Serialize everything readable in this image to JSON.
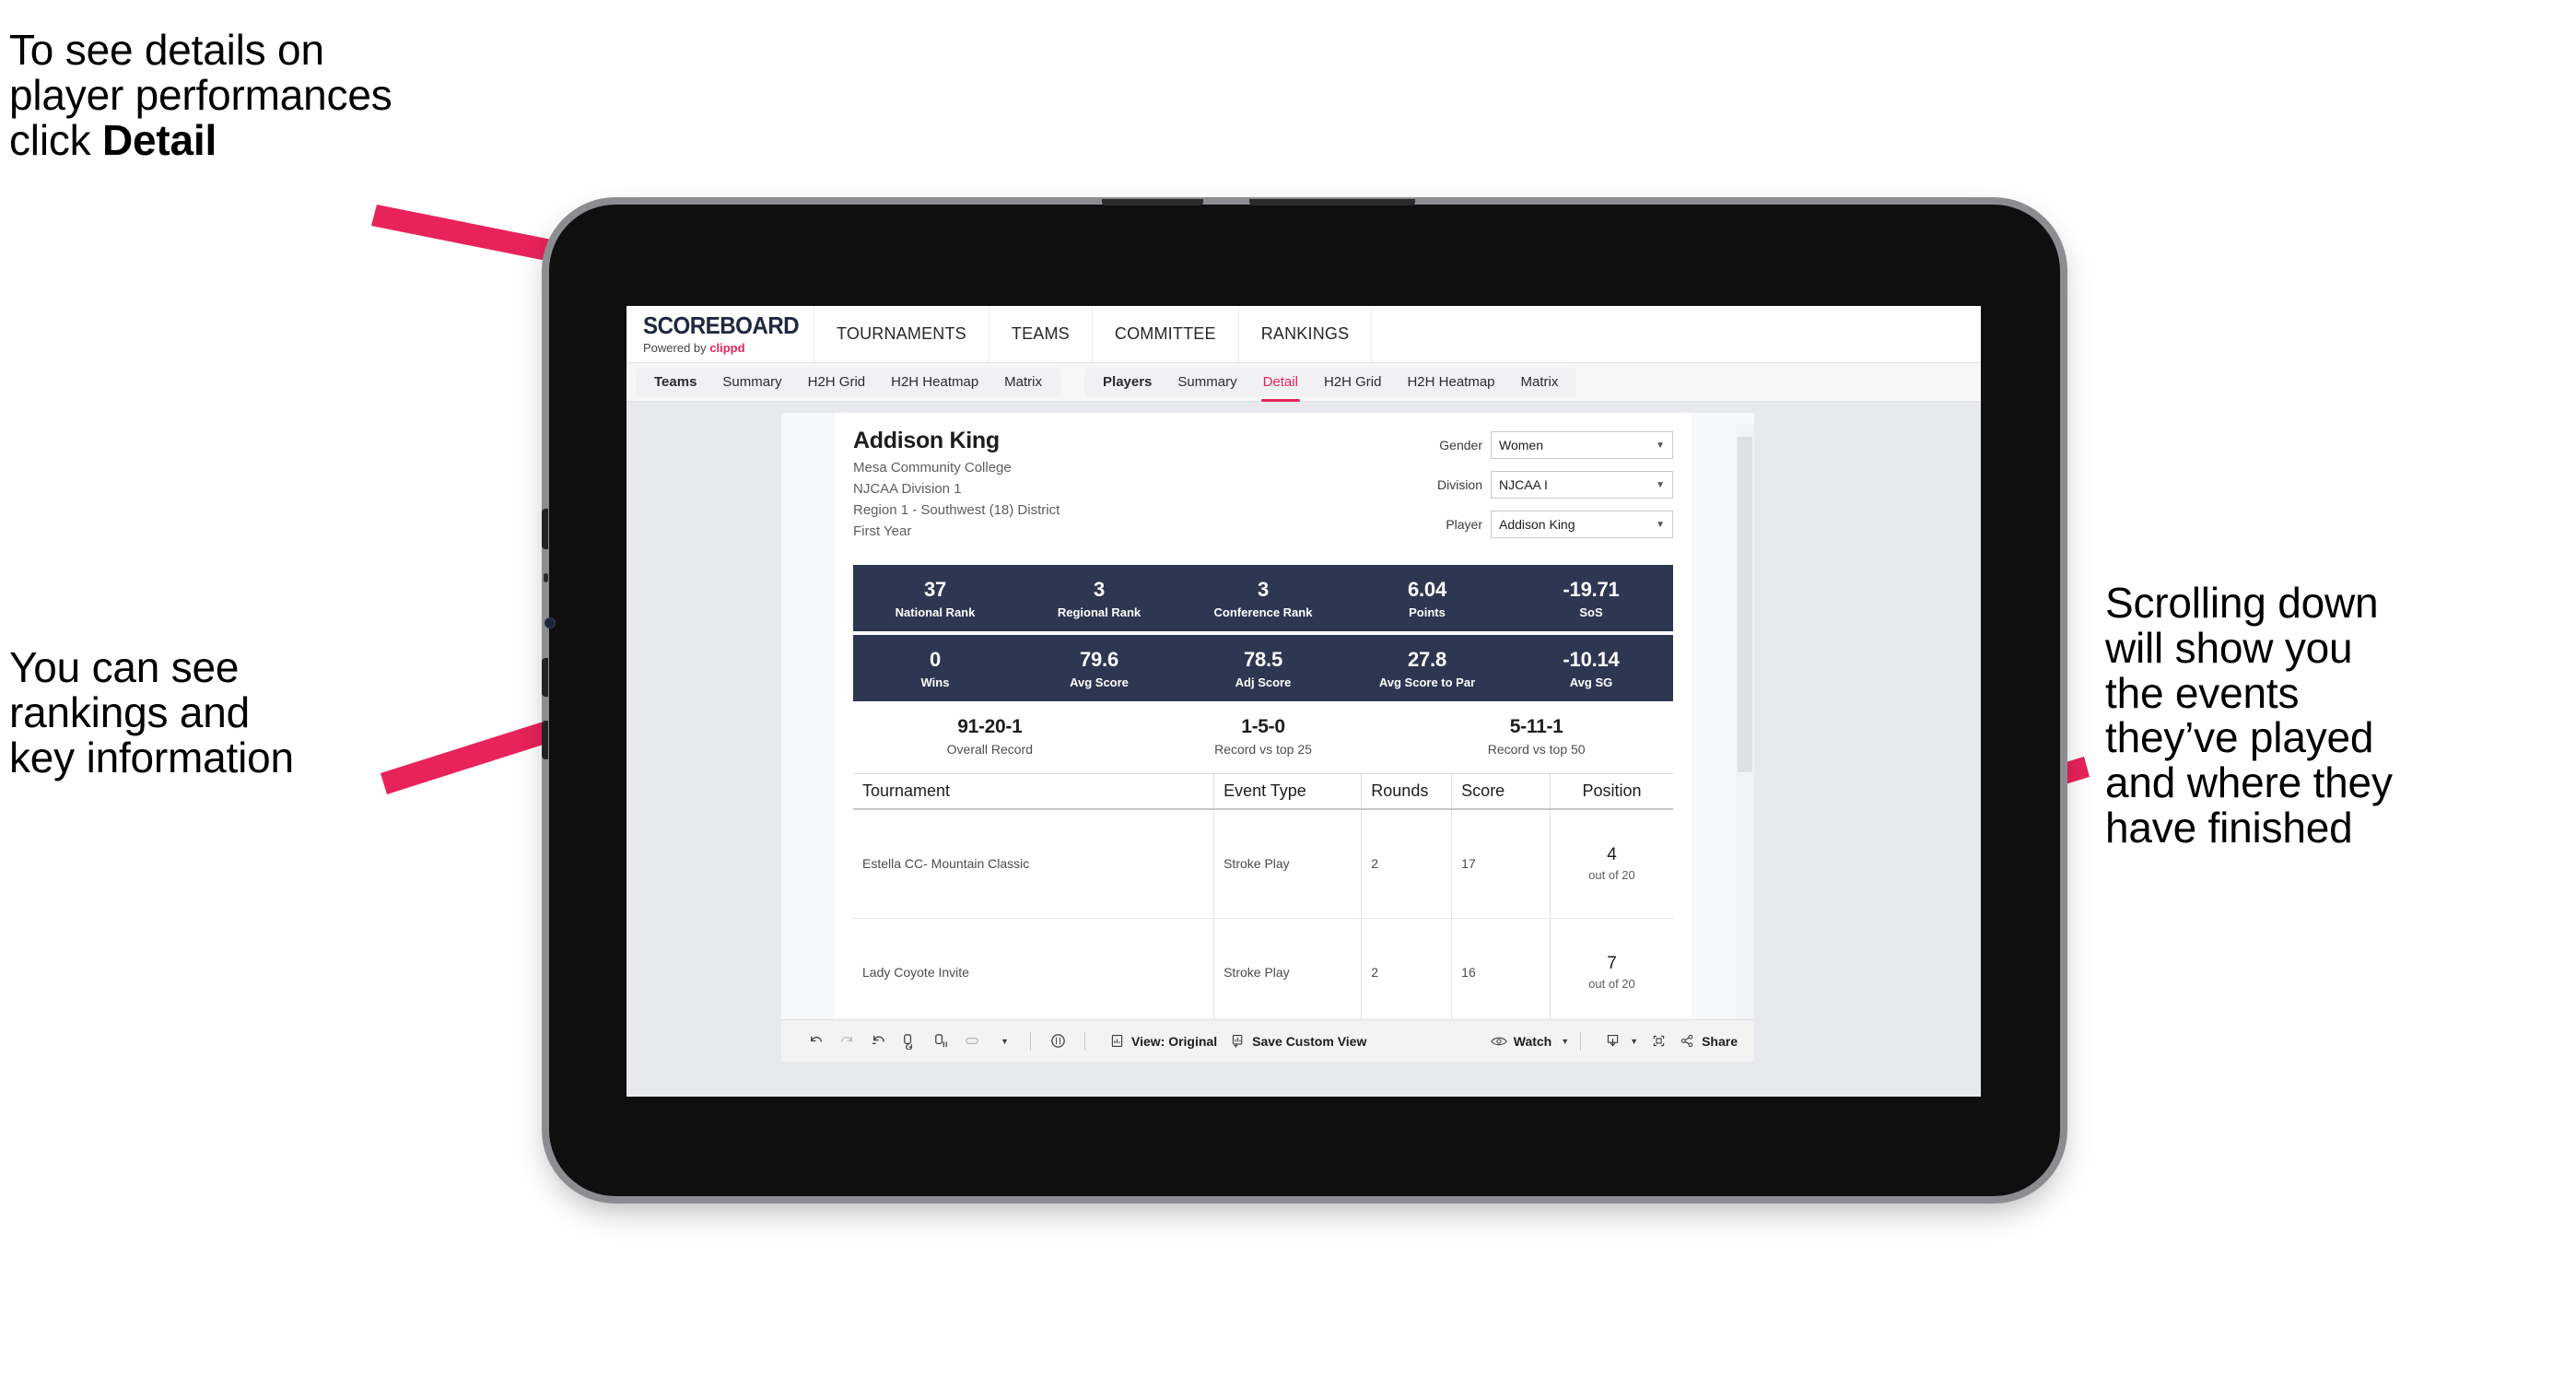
{
  "annotations": {
    "top_left": "To see details on\nplayer performances\nclick ",
    "top_left_bold": "Detail",
    "bottom_left": "You can see\nrankings and\nkey information",
    "right": "Scrolling down\nwill show you\nthe events\nthey’ve played\nand where they\nhave finished",
    "arrow_color": "#e8235a"
  },
  "app": {
    "brand": {
      "title": "SCOREBOARD",
      "powered_prefix": "Powered by ",
      "powered_brand": "clippd"
    },
    "top_nav": [
      "TOURNAMENTS",
      "TEAMS",
      "COMMITTEE",
      "RANKINGS"
    ],
    "sub_nav_left": [
      "Teams",
      "Summary",
      "H2H Grid",
      "H2H Heatmap",
      "Matrix"
    ],
    "sub_nav_right": [
      "Players",
      "Summary",
      "Detail",
      "H2H Grid",
      "H2H Heatmap",
      "Matrix"
    ],
    "sub_nav_active": "Detail"
  },
  "player": {
    "name": "Addison King",
    "school": "Mesa Community College",
    "division": "NJCAA Division 1",
    "region": "Region 1 - Southwest (18) District",
    "year": "First Year"
  },
  "filters": [
    {
      "label": "Gender",
      "value": "Women"
    },
    {
      "label": "Division",
      "value": "NJCAA I"
    },
    {
      "label": "Player",
      "value": "Addison King"
    }
  ],
  "stats_row_1": [
    {
      "value": "37",
      "label": "National Rank"
    },
    {
      "value": "3",
      "label": "Regional Rank"
    },
    {
      "value": "3",
      "label": "Conference Rank"
    },
    {
      "value": "6.04",
      "label": "Points"
    },
    {
      "value": "-19.71",
      "label": "SoS"
    }
  ],
  "stats_row_2": [
    {
      "value": "0",
      "label": "Wins"
    },
    {
      "value": "79.6",
      "label": "Avg Score"
    },
    {
      "value": "78.5",
      "label": "Adj Score"
    },
    {
      "value": "27.8",
      "label": "Avg Score to Par"
    },
    {
      "value": "-10.14",
      "label": "Avg SG"
    }
  ],
  "records": [
    {
      "value": "91-20-1",
      "label": "Overall Record"
    },
    {
      "value": "1-5-0",
      "label": "Record vs top 25"
    },
    {
      "value": "5-11-1",
      "label": "Record vs top 50"
    }
  ],
  "table": {
    "headers": [
      "Tournament",
      "Event Type",
      "Rounds",
      "Score",
      "Position"
    ],
    "rows": [
      {
        "tournament": "Estella CC- Mountain Classic",
        "event_type": "Stroke Play",
        "rounds": "2",
        "score": "17",
        "position": "4",
        "position_of": "out of 20"
      },
      {
        "tournament": "Lady Coyote Invite",
        "event_type": "Stroke Play",
        "rounds": "2",
        "score": "16",
        "position": "7",
        "position_of": "out of 20"
      }
    ]
  },
  "toolbar": {
    "view_label": "View: Original",
    "save_label": "Save Custom View",
    "watch_label": "Watch",
    "share_label": "Share"
  }
}
